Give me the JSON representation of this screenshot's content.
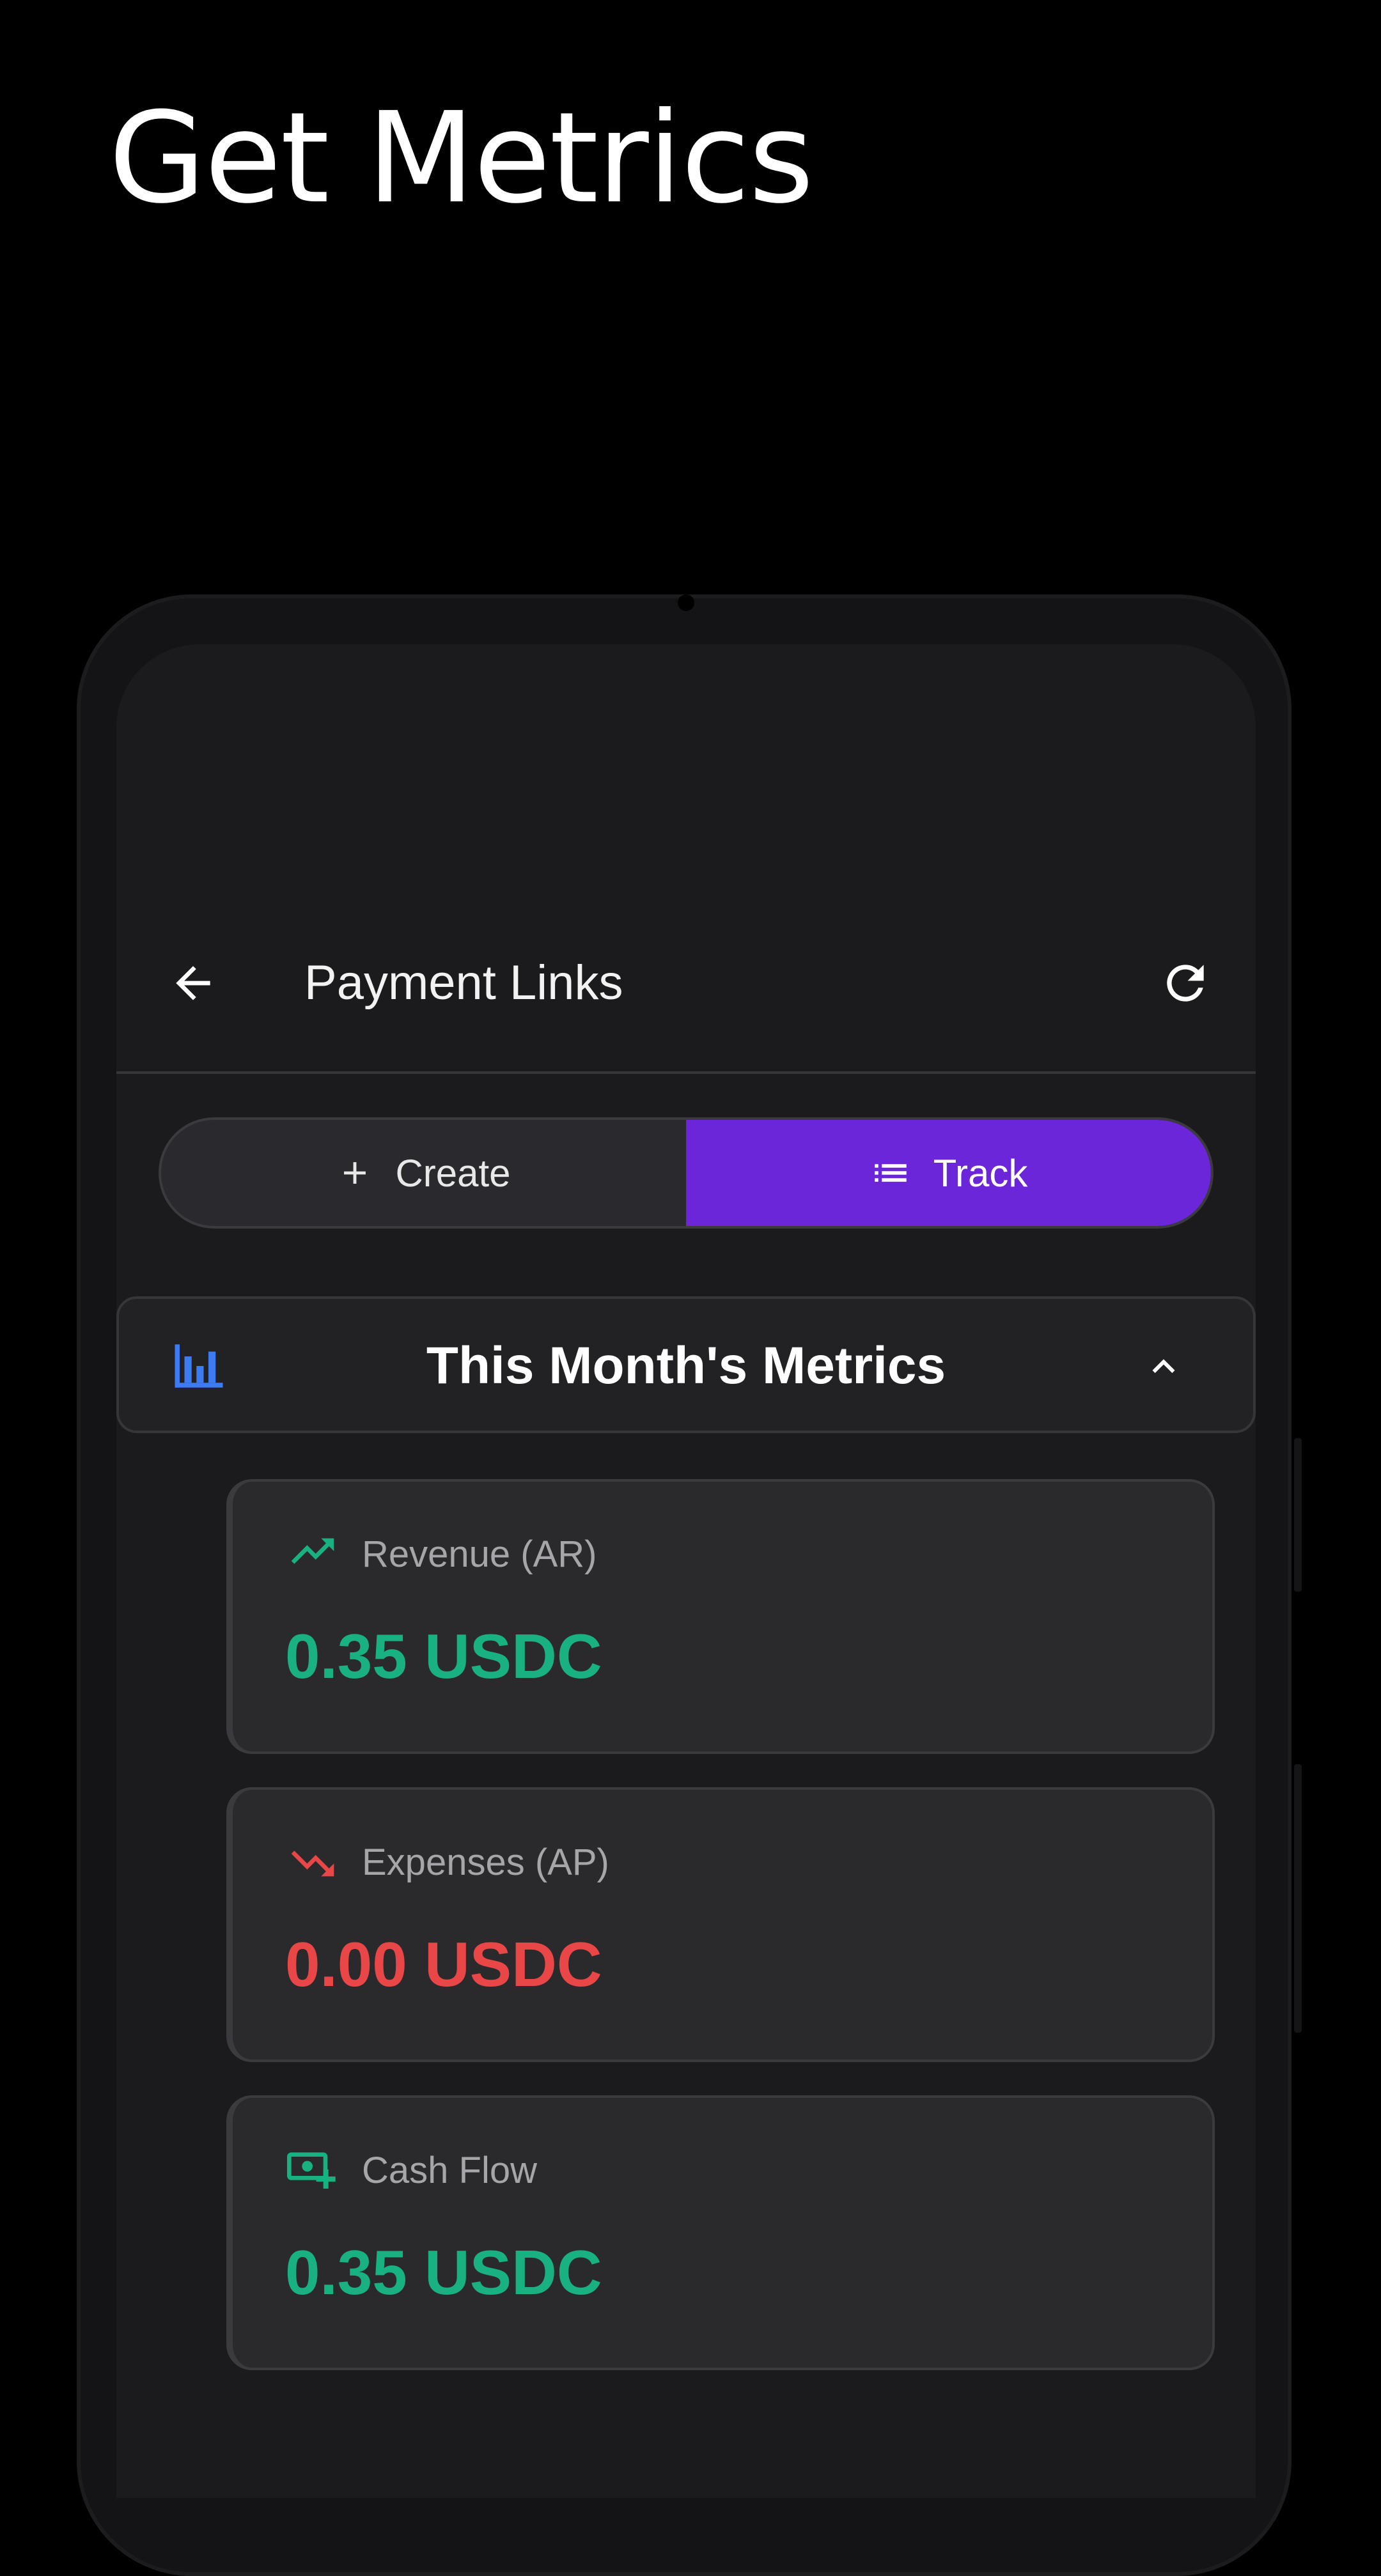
{
  "headline": "Get Metrics",
  "appbar": {
    "title": "Payment Links"
  },
  "tabs": [
    {
      "label": "Create",
      "icon": "plus-icon",
      "active": false
    },
    {
      "label": "Track",
      "icon": "list-icon",
      "active": true
    }
  ],
  "metrics": {
    "title": "This Month's Metrics",
    "icon": "bar-chart-icon",
    "expanded": true,
    "cards": [
      {
        "label": "Revenue (AR)",
        "value": "0.35 USDC",
        "icon": "trending-up-icon",
        "color": "#19b082"
      },
      {
        "label": "Expenses (AP)",
        "value": "0.00 USDC",
        "icon": "trending-down-icon",
        "color": "#e94747"
      },
      {
        "label": "Cash Flow",
        "value": "0.35 USDC",
        "icon": "cash-add-icon",
        "color": "#19b082"
      }
    ]
  },
  "colors": {
    "accent": "#6a26d8",
    "positive": "#19b082",
    "negative": "#e94747",
    "metrics_icon": "#3d7bf2",
    "background": "#000000",
    "screen": "#1b1b1d"
  }
}
